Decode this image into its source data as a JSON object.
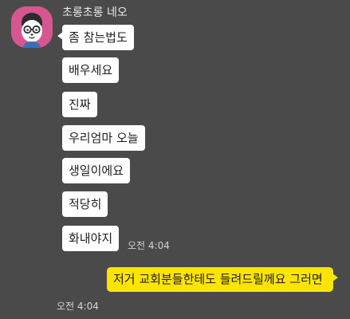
{
  "chat": {
    "sender": {
      "name": "초롱초롱 네오",
      "avatar_icon": "neo-character-avatar-icon"
    },
    "received_messages": [
      {
        "text": "좀 참는법도"
      },
      {
        "text": "배우세요"
      },
      {
        "text": "진짜"
      },
      {
        "text": "우리엄마 오늘"
      },
      {
        "text": "생일이에요"
      },
      {
        "text": "적당히"
      },
      {
        "text": "화내야지"
      }
    ],
    "received_time": "오전 4:04",
    "sent_message": {
      "text": "저거 교회분들한테도 들려드릴께요 그러면",
      "time": "오전 4:04"
    }
  },
  "colors": {
    "background": "#4a4a4a",
    "received_bubble": "#ffffff",
    "sent_bubble": "#fee500",
    "avatar_background": "#d6578f"
  }
}
